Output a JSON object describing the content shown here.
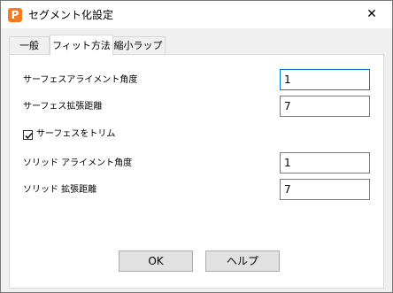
{
  "window": {
    "title": "セグメント化設定",
    "icon_letter": "P",
    "close_glyph": "✕"
  },
  "tabs": [
    {
      "label": "一般",
      "active": false
    },
    {
      "label": "フィット方法",
      "active": true
    },
    {
      "label": "縮小ラップ",
      "active": false
    }
  ],
  "form": {
    "surface_alignment_angle": {
      "label": "サーフェスアライメント角度",
      "value": "1"
    },
    "surface_extension_distance": {
      "label": "サーフェス拡張距離",
      "value": "7"
    },
    "trim_surface": {
      "label": "サーフェスをトリム",
      "checked": true
    },
    "solid_alignment_angle": {
      "label": "ソリッド アライメント角度",
      "value": "1"
    },
    "solid_extension_distance": {
      "label": "ソリッド 拡張距離",
      "value": "7"
    }
  },
  "buttons": {
    "ok": "OK",
    "help": "ヘルプ"
  },
  "colors": {
    "accent": "#0078d7",
    "icon_bg": "#f47b20"
  }
}
